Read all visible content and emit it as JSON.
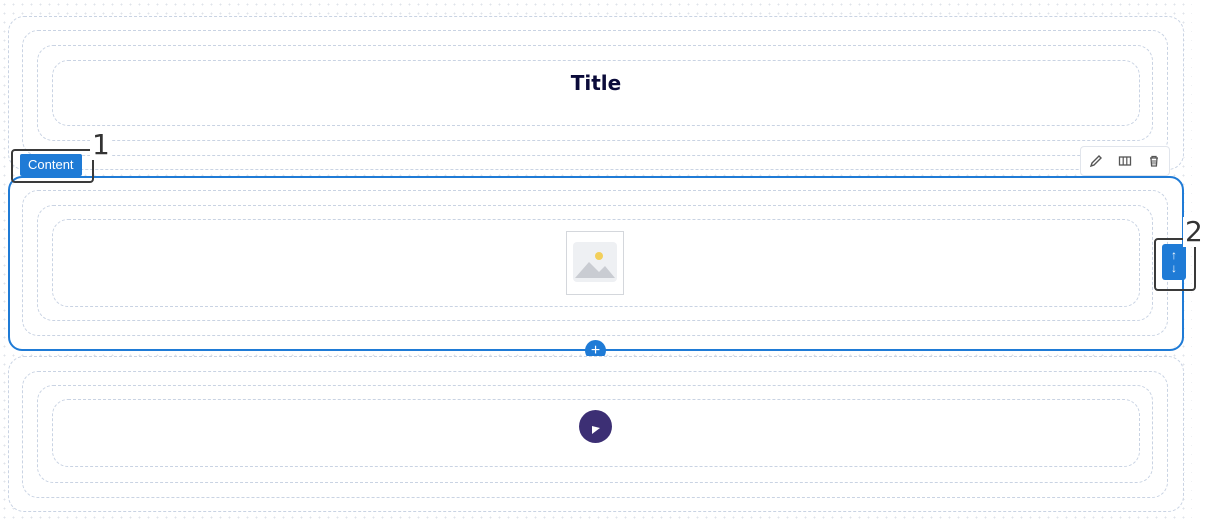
{
  "title_section": {
    "text": "Title"
  },
  "content_section": {
    "tag_label": "Content"
  },
  "toolbar": {
    "edit": "pencil-icon",
    "columns": "columns-icon",
    "delete": "trash-icon"
  },
  "add_button": {
    "symbol": "+"
  },
  "move_handle": {
    "up": "↑",
    "down": "↓"
  },
  "callouts": [
    "1",
    "2"
  ],
  "colors": {
    "accent": "#1f7bd6",
    "logo_bg": "#3c2f74",
    "title_text": "#0b0b3a"
  }
}
